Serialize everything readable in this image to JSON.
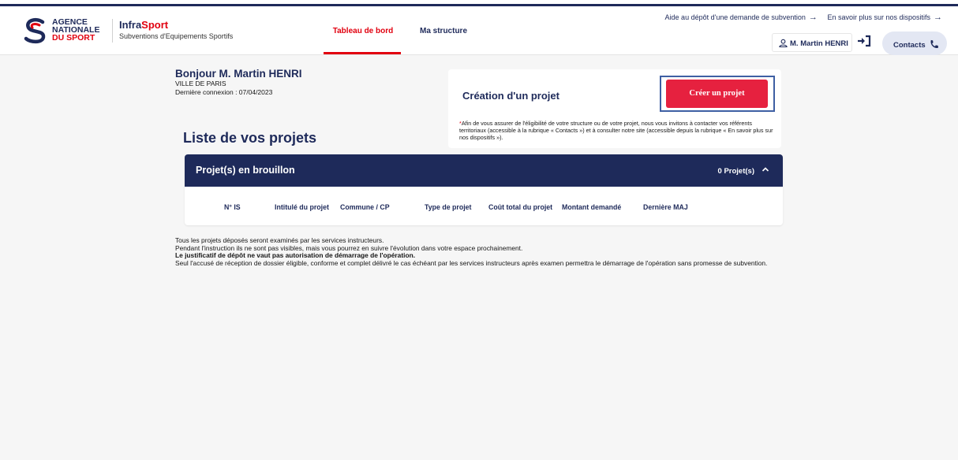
{
  "brand": {
    "logo_lines": [
      "AGENCE",
      "NATIONALE",
      "DU SPORT"
    ],
    "app_name_prefix": "Infra",
    "app_name_accent": "Sport",
    "app_subtitle": "Subventions d'Equipements Sportifs",
    "colors": {
      "navy": "#1e2a5a",
      "red": "#e1000f",
      "button_red": "#e6213f"
    }
  },
  "toplinks": {
    "help": "Aide au dépôt d'une demande de subvention",
    "more": "En savoir plus sur nos dispositifs"
  },
  "nav": {
    "dashboard": "Tableau de bord",
    "structure": "Ma structure"
  },
  "user": {
    "name": "M. Martin HENRI",
    "contacts": "Contacts"
  },
  "greeting": {
    "title": "Bonjour M. Martin HENRI",
    "organization": "VILLE DE PARIS",
    "last_login": "Dernière connexion : 07/04/2023"
  },
  "create": {
    "title": "Création d'un projet",
    "button": "Créer un projet",
    "note_star": "*",
    "note": "Afin de vous assurer de l'éligibilité de votre structure ou de votre projet, nous vous invitons à contacter vos référents territoriaux (accessible à la rubrique « Contacts ») et à consulter notre site (accessible depuis la rubrique « En savoir plus sur nos dispositifs »)."
  },
  "projects": {
    "list_title": "Liste de vos projets",
    "draft_title": "Projet(s) en brouillon",
    "draft_count": "0 Projet(s)",
    "columns": [
      "N° IS",
      "Intitulé du projet",
      "Commune / CP",
      "Type de projet",
      "Coût total du projet",
      "Montant demandé",
      "Dernière MAJ"
    ]
  },
  "infos": {
    "line1": "Tous les projets déposés seront examinés par les services instructeurs.",
    "line2": "Pendant l'instruction ils ne sont pas visibles, mais vous pourrez en suivre l'évolution dans votre espace prochainement.",
    "line3": "Le justificatif de dépôt ne vaut pas autorisation de démarrage de l'opération.",
    "line4": "Seul l'accusé de réception de dossier éligible, conforme et complet délivré le cas échéant par les services instructeurs après examen permettra le démarrage de l'opération sans promesse de subvention."
  }
}
